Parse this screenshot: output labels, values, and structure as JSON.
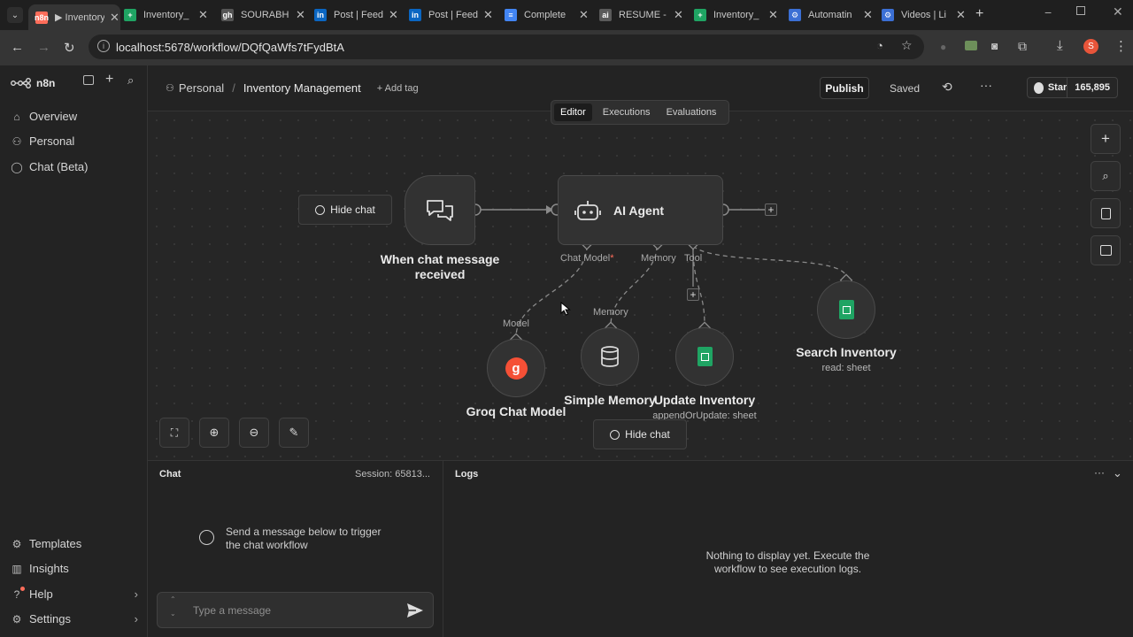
{
  "browser": {
    "tabs": [
      {
        "title": "▶ Inventory",
        "fav": "n8n",
        "color": "#ff6d5a"
      },
      {
        "title": "Inventory_",
        "fav": "+",
        "color": "#1fa463"
      },
      {
        "title": "SOURABH",
        "fav": "gh",
        "color": "#555555"
      },
      {
        "title": "Post | Feed",
        "fav": "in",
        "color": "#0a66c2"
      },
      {
        "title": "Post | Feed",
        "fav": "in",
        "color": "#0a66c2"
      },
      {
        "title": "Complete",
        "fav": "≡",
        "color": "#4285f4"
      },
      {
        "title": "RESUME -",
        "fav": "ai",
        "color": "#5a5a5a"
      },
      {
        "title": "Inventory_",
        "fav": "+",
        "color": "#1fa463"
      },
      {
        "title": "Automatin",
        "fav": "⚙",
        "color": "#3b6fd4"
      },
      {
        "title": "Videos | Li",
        "fav": "⚙",
        "color": "#3b6fd4"
      }
    ],
    "url": "localhost:5678/workflow/DQfQaWfs7tFydBtA",
    "profile_initial": "S"
  },
  "sidebar": {
    "brand": "n8n",
    "items": [
      {
        "label": "Overview",
        "icon": "home-icon"
      },
      {
        "label": "Personal",
        "icon": "user-icon"
      },
      {
        "label": "Chat (Beta)",
        "icon": "chat-icon"
      }
    ],
    "bottom": [
      {
        "label": "Templates",
        "icon": "templates-icon"
      },
      {
        "label": "Insights",
        "icon": "insights-icon"
      },
      {
        "label": "Help",
        "icon": "help-icon"
      },
      {
        "label": "Settings",
        "icon": "settings-icon"
      }
    ]
  },
  "header": {
    "breadcrumb_project": "Personal",
    "separator": "/",
    "workflow_name": "Inventory Management",
    "add_tag": "+ Add tag",
    "publish": "Publish",
    "saved": "Saved",
    "github_star": "Star",
    "github_count": "165,895"
  },
  "tabs": {
    "editor": "Editor",
    "executions": "Executions",
    "evaluations": "Evaluations"
  },
  "canvas": {
    "hide_chat_top": "Hide chat",
    "hide_chat_bottom": "Hide chat",
    "nodes": {
      "trigger": {
        "line1": "When chat message",
        "line2": "received"
      },
      "agent": {
        "title": "AI Agent"
      },
      "groq": {
        "title": "Groq Chat Model"
      },
      "memory": {
        "title": "Simple Memory"
      },
      "update": {
        "title": "Update Inventory",
        "sub": "appendOrUpdate: sheet"
      },
      "search": {
        "title": "Search Inventory",
        "sub": "read: sheet"
      }
    },
    "ports": {
      "chat_model": "Chat Model",
      "required_mark": "*",
      "memory": "Memory",
      "tool": "Tool",
      "model_in": "Model",
      "memory_in": "Memory"
    }
  },
  "chat_panel": {
    "title": "Chat",
    "session": "Session: 65813...",
    "empty_text": "Send a message below to trigger the chat workflow",
    "input_placeholder": "Type a message"
  },
  "logs_panel": {
    "title": "Logs",
    "empty_text": "Nothing to display yet. Execute the workflow to see execution logs."
  }
}
